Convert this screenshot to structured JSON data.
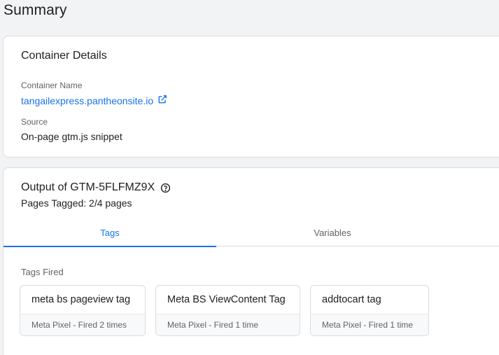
{
  "page": {
    "title": "Summary"
  },
  "container_details": {
    "title": "Container Details",
    "name_label": "Container Name",
    "name_value": "tangailexpress.pantheonsite.io",
    "source_label": "Source",
    "source_value": "On-page gtm.js snippet"
  },
  "output": {
    "title": "Output of GTM-5FLFMZ9X",
    "pages_tagged": "Pages Tagged: 2/4 pages",
    "tabs": [
      {
        "label": "Tags",
        "active": true
      },
      {
        "label": "Variables",
        "active": false
      }
    ],
    "section_label": "Tags Fired",
    "tags": [
      {
        "name": "meta bs pageview tag",
        "meta": "Meta Pixel - Fired 2 times"
      },
      {
        "name": "Meta BS ViewContent Tag",
        "meta": "Meta Pixel - Fired 1 time"
      },
      {
        "name": "addtocart tag",
        "meta": "Meta Pixel - Fired 1 time"
      }
    ]
  },
  "icons": {
    "external_link": "external-link-icon",
    "help": "help-circle-icon"
  },
  "colors": {
    "accent": "#1a73e8",
    "background": "#f1f3f4",
    "border": "#dadce0",
    "muted_text": "#5f6368"
  }
}
